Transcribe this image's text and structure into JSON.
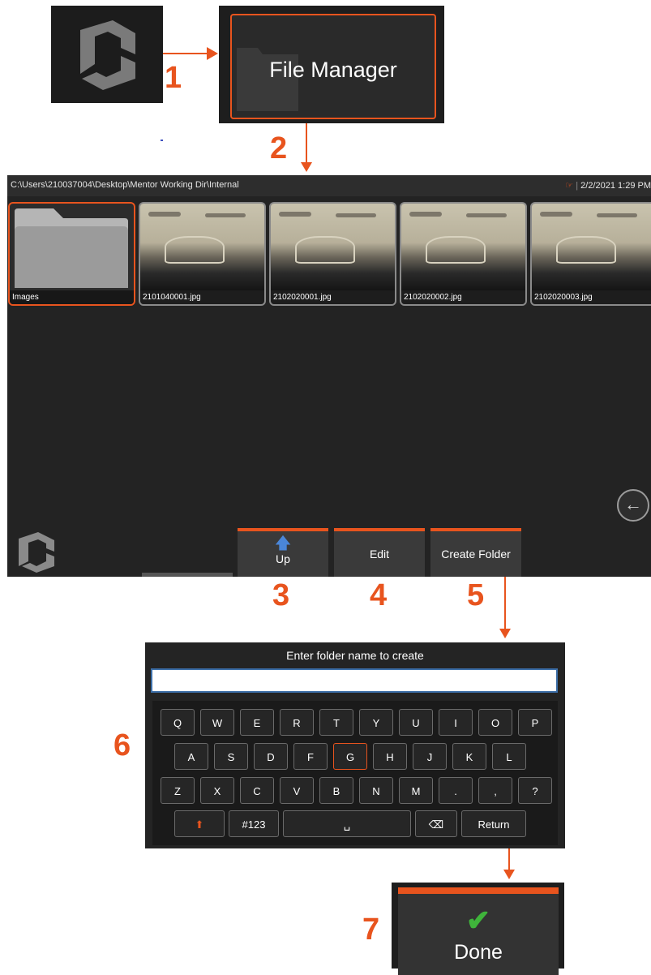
{
  "steps": [
    "1",
    "2",
    "3",
    "4",
    "5",
    "6",
    "7"
  ],
  "file_manager_tile": {
    "label": "File Manager"
  },
  "screen": {
    "path": "C:\\Users\\210037004\\Desktop\\Mentor Working Dir\\Internal",
    "datetime": "2/2/2021  1:29 PM",
    "items": [
      {
        "label": "Images",
        "type": "folder"
      },
      {
        "label": "2101040001.jpg",
        "type": "image"
      },
      {
        "label": "2102020001.jpg",
        "type": "image"
      },
      {
        "label": "2102020002.jpg",
        "type": "image"
      },
      {
        "label": "2102020003.jpg",
        "type": "image"
      }
    ],
    "buttons": {
      "up": "Up",
      "edit": "Edit",
      "create_folder": "Create Folder"
    }
  },
  "keyboard": {
    "prompt": "Enter folder name to create",
    "input_value": "",
    "row1": [
      "Q",
      "W",
      "E",
      "R",
      "T",
      "Y",
      "U",
      "I",
      "O",
      "P"
    ],
    "row2": [
      "A",
      "S",
      "D",
      "F",
      "G",
      "H",
      "J",
      "K",
      "L"
    ],
    "row3": [
      "Z",
      "X",
      "C",
      "V",
      "B",
      "N",
      "M",
      ".",
      ",",
      "?"
    ],
    "row4": {
      "numbers": "#123",
      "return": "Return"
    },
    "selected_key": "G"
  },
  "done": {
    "label": "Done"
  },
  "colors": {
    "accent": "#e8541e",
    "check": "#3fb43b"
  }
}
